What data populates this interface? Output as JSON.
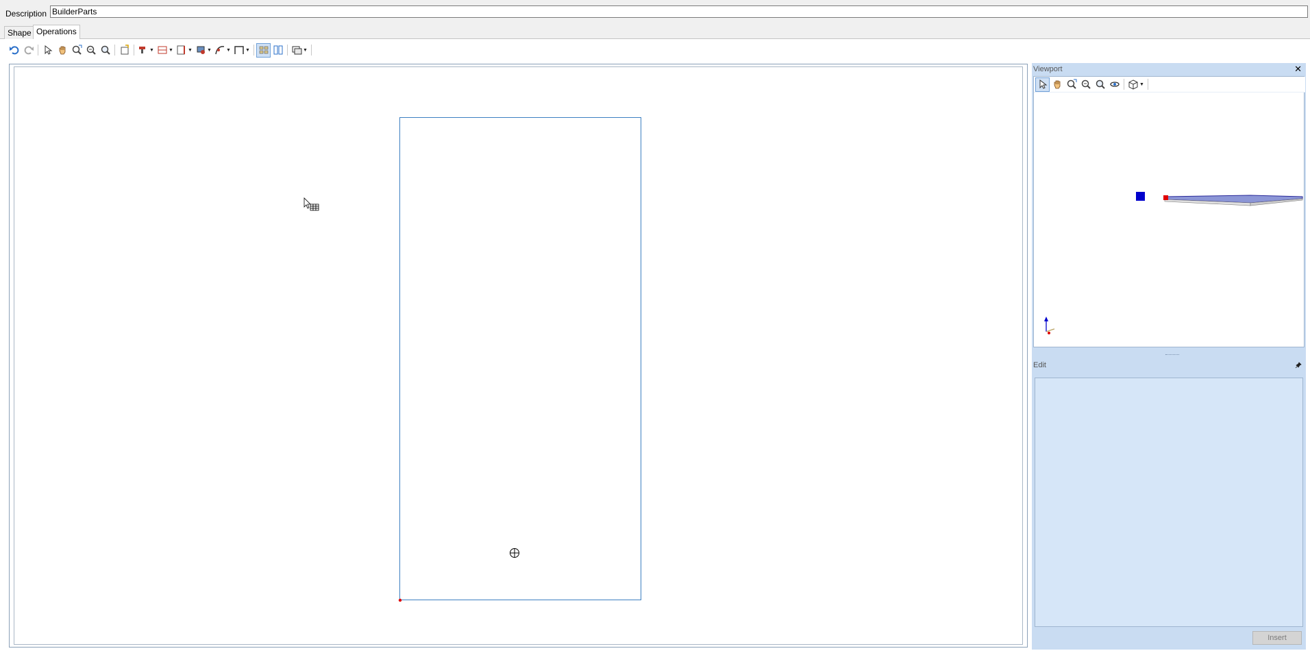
{
  "description": {
    "label": "Description",
    "value": "BuilderParts"
  },
  "tabs": [
    {
      "label": "Shape",
      "active": false
    },
    {
      "label": "Operations",
      "active": true
    }
  ],
  "toolbar": {
    "icons": [
      "undo-icon",
      "redo-icon",
      "select-arrow-icon",
      "pan-hand-icon",
      "zoom-extents-icon",
      "zoom-in-icon",
      "zoom-window-icon",
      "new-part-icon",
      "drill-icon",
      "groove-icon",
      "panel-edge-icon",
      "pocket-icon",
      "curve-icon",
      "profile-icon",
      "grid-view-icon",
      "split-view-icon",
      "display-mode-icon"
    ]
  },
  "viewport": {
    "title": "Viewport",
    "close_glyph": "✕",
    "icons": [
      "select-arrow-icon",
      "pan-hand-icon",
      "zoom-extents-icon",
      "zoom-out-icon",
      "zoom-in-icon",
      "orbit-icon",
      "view-cube-icon"
    ]
  },
  "edit": {
    "title": "Edit",
    "pin_glyph": "📌",
    "insert_label": "Insert"
  },
  "colors": {
    "accent": "#3c7fc1",
    "panel_bg": "#c9dcf2",
    "edit_bg": "#d6e6f8",
    "origin_marker": "#e00000",
    "viewport_square": "#0000cc"
  }
}
